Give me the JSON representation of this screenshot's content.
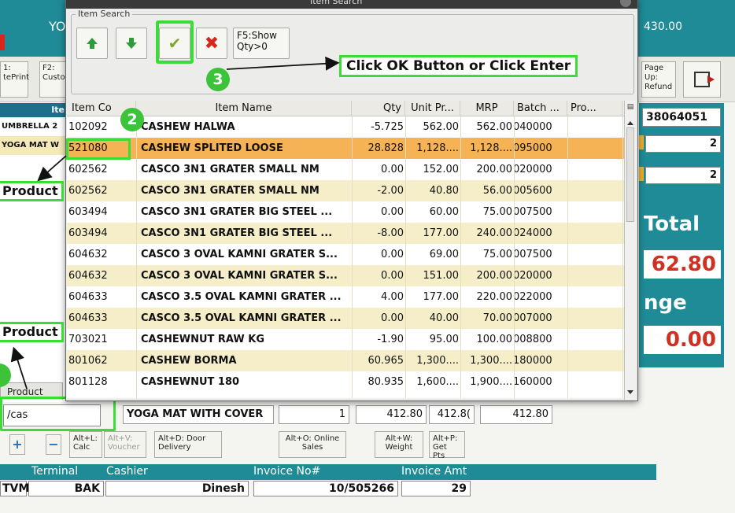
{
  "app": {
    "header_title_partial": "YO",
    "header_amount": "430.00",
    "toolbar": {
      "f1_label": "1: tePrint",
      "f2_label": "F2: Custo",
      "pgup_label": "Page Up: Refund"
    },
    "left_list": {
      "header": "Ite",
      "rows": [
        "UMBRELLA 2",
        "YOGA MAT W"
      ]
    },
    "right_panel": {
      "barcode": "38064051",
      "qty1": "2",
      "qty2": "2",
      "total_label": "Total",
      "total_value": "62.80",
      "change_label": "nge",
      "change_value": "0.00"
    },
    "product_tab": "Product",
    "search_value": "/cas",
    "line_item": {
      "name": "YOGA MAT WITH COVER",
      "qty": "1",
      "price": "412.80",
      "mrp": "412.8(",
      "amount": "412.80"
    },
    "bottom_buttons": {
      "plus": "+",
      "minus": "−",
      "calc": "Alt+L: Calc",
      "voucher": "Alt+V: Voucher",
      "door": "Alt+D: Door Delivery",
      "online": "Alt+O: Online Sales",
      "weight": "Alt+W: Weight",
      "points": "Alt+P: Get Pts"
    },
    "footer": {
      "labels": {
        "terminal": "Terminal",
        "cashier": "Cashier",
        "invoice_no": "Invoice No#",
        "invoice_amt": "Invoice Amt"
      },
      "values": {
        "pos": "TVM",
        "terminal": "BAK",
        "cashier": "Dinesh",
        "invoice_no": "10/505266",
        "invoice_amt": "29"
      }
    }
  },
  "modal": {
    "title": "Item Search",
    "group_label": "Item Search",
    "f5_label": "F5:Show Qty>0",
    "columns": [
      "Item Co",
      "Item Name",
      "Qty",
      "Unit Pr...",
      "MRP",
      "Batch ...",
      "Pro..."
    ],
    "rows": [
      {
        "code": "102092",
        "name": "CASHEW HALWA",
        "qty": "-5.725",
        "unit": "562.00",
        "mrp": "562.00",
        "batch": "040000"
      },
      {
        "code": "521080",
        "name": "CASHEW SPLITED LOOSE",
        "qty": "28.828",
        "unit": "1,128....",
        "mrp": "1,128....",
        "batch": "095000"
      },
      {
        "code": "602562",
        "name": "CASCO 3N1 GRATER SMALL NM",
        "qty": "0.00",
        "unit": "152.00",
        "mrp": "200.00",
        "batch": "020000"
      },
      {
        "code": "602562",
        "name": "CASCO 3N1 GRATER SMALL NM",
        "qty": "-2.00",
        "unit": "40.80",
        "mrp": "56.00",
        "batch": "005600"
      },
      {
        "code": "603494",
        "name": "CASCO 3N1 GRATER BIG STEEL ...",
        "qty": "0.00",
        "unit": "60.00",
        "mrp": "75.00",
        "batch": "007500"
      },
      {
        "code": "603494",
        "name": "CASCO 3N1 GRATER BIG STEEL ...",
        "qty": "-8.00",
        "unit": "177.00",
        "mrp": "240.00",
        "batch": "024000"
      },
      {
        "code": "604632",
        "name": "CASCO 3 OVAL KAMNI GRATER S...",
        "qty": "0.00",
        "unit": "69.00",
        "mrp": "75.00",
        "batch": "007500"
      },
      {
        "code": "604632",
        "name": "CASCO 3 OVAL KAMNI GRATER S...",
        "qty": "0.00",
        "unit": "151.00",
        "mrp": "200.00",
        "batch": "020000"
      },
      {
        "code": "604633",
        "name": "CASCO 3.5 OVAL KAMNI GRATER ...",
        "qty": "4.00",
        "unit": "177.00",
        "mrp": "220.00",
        "batch": "022000"
      },
      {
        "code": "604633",
        "name": "CASCO 3.5 OVAL KAMNI GRATER ...",
        "qty": "0.00",
        "unit": "40.00",
        "mrp": "70.00",
        "batch": "007000"
      },
      {
        "code": "703021",
        "name": "CASHEWNUT RAW KG",
        "qty": "-1.90",
        "unit": "95.00",
        "mrp": "100.00",
        "batch": "008800"
      },
      {
        "code": "801062",
        "name": "CASHEW BORMA",
        "qty": "60.965",
        "unit": "1,300....",
        "mrp": "1,300....",
        "batch": "180000"
      },
      {
        "code": "801128",
        "name": "CASHEWNUT 180",
        "qty": "80.935",
        "unit": "1,600....",
        "mrp": "1,900....",
        "batch": "160000"
      }
    ]
  },
  "annotations": {
    "ok_callout": "Click OK Button or Click Enter",
    "product_callout": "Product",
    "step_2": "2",
    "step_3": "3"
  },
  "colors": {
    "teal": "#1e8b96",
    "highlight_green": "#3cdc38",
    "selected_row": "#f5b355",
    "alt_row": "#f5eec8"
  }
}
